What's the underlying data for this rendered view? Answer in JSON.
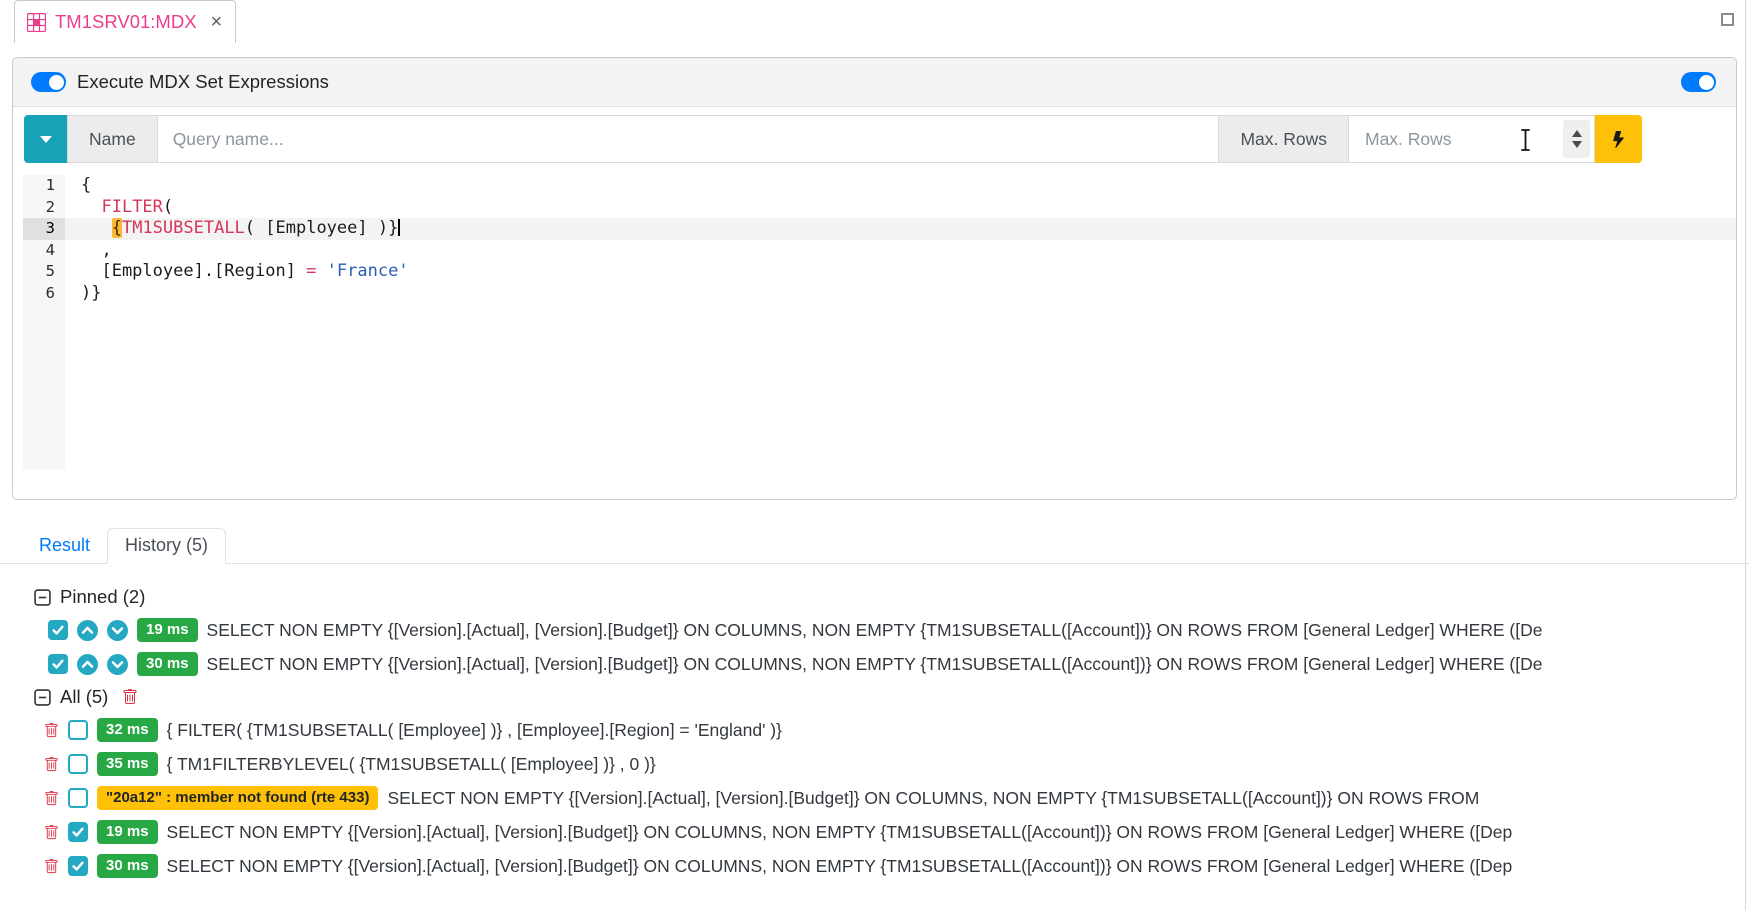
{
  "tab": {
    "title": "TM1SRV01:MDX",
    "close_glyph": "×"
  },
  "window": {
    "maximize_icon": "square-outline"
  },
  "toolbar": {
    "title": "Execute MDX Set Expressions",
    "toggle_left": "on",
    "toggle_right": "on"
  },
  "query_bar": {
    "dropdown_icon": "caret-down",
    "name_label": "Name",
    "name_placeholder": "Query name...",
    "name_value": "",
    "max_rows_label": "Max. Rows",
    "max_rows_placeholder": "Max. Rows",
    "max_rows_value": "",
    "execute_icon": "lightning-bolt"
  },
  "editor": {
    "lines": [
      {
        "no": 1,
        "active": false,
        "caret": false,
        "segments": [
          {
            "t": "plain",
            "v": "{"
          }
        ]
      },
      {
        "no": 2,
        "active": false,
        "caret": false,
        "segments": [
          {
            "t": "plain",
            "v": "  "
          },
          {
            "t": "keyword",
            "v": "FILTER"
          },
          {
            "t": "plain",
            "v": "("
          }
        ]
      },
      {
        "no": 3,
        "active": true,
        "caret": true,
        "segments": [
          {
            "t": "plain",
            "v": "   "
          },
          {
            "t": "brace",
            "v": "{"
          },
          {
            "t": "keyword",
            "v": "TM1SUBSETALL"
          },
          {
            "t": "plain",
            "v": "( [Employee] )}"
          }
        ]
      },
      {
        "no": 4,
        "active": false,
        "caret": false,
        "segments": [
          {
            "t": "plain",
            "v": "  ,"
          }
        ]
      },
      {
        "no": 5,
        "active": false,
        "caret": false,
        "segments": [
          {
            "t": "plain",
            "v": "  [Employee].[Region] "
          },
          {
            "t": "keyword",
            "v": "="
          },
          {
            "t": "plain",
            "v": " "
          },
          {
            "t": "string",
            "v": "'France'"
          }
        ]
      },
      {
        "no": 6,
        "active": false,
        "caret": false,
        "segments": [
          {
            "t": "plain",
            "v": ")}"
          }
        ]
      }
    ]
  },
  "tabs": {
    "result": "Result",
    "history": "History (5)"
  },
  "history": {
    "pinned": {
      "label": "Pinned (2)",
      "items": [
        {
          "checked": true,
          "badge": "19 ms",
          "badge_type": "success",
          "text": "SELECT NON EMPTY {[Version].[Actual], [Version].[Budget]} ON COLUMNS, NON EMPTY {TM1SUBSETALL([Account])} ON ROWS FROM [General Ledger] WHERE ([De"
        },
        {
          "checked": true,
          "badge": "30 ms",
          "badge_type": "success",
          "text": "SELECT NON EMPTY {[Version].[Actual], [Version].[Budget]} ON COLUMNS, NON EMPTY {TM1SUBSETALL([Account])} ON ROWS FROM [General Ledger] WHERE ([De"
        }
      ]
    },
    "all": {
      "label": "All (5)",
      "items": [
        {
          "checked": false,
          "badge": "32 ms",
          "badge_type": "success",
          "text": "{ FILTER( {TM1SUBSETALL( [Employee] )} , [Employee].[Region] = 'England' )}"
        },
        {
          "checked": false,
          "badge": "35 ms",
          "badge_type": "success",
          "text": "{ TM1FILTERBYLEVEL( {TM1SUBSETALL( [Employee] )} , 0 )}"
        },
        {
          "checked": false,
          "badge": "\"20a12\" : member not found (rte 433)",
          "badge_type": "warning",
          "text": "SELECT NON EMPTY {[Version].[Actual], [Version].[Budget]} ON COLUMNS, NON EMPTY {TM1SUBSETALL([Account])} ON ROWS FROM"
        },
        {
          "checked": true,
          "badge": "19 ms",
          "badge_type": "success",
          "text": "SELECT NON EMPTY {[Version].[Actual], [Version].[Budget]} ON COLUMNS, NON EMPTY {TM1SUBSETALL([Account])} ON ROWS FROM [General Ledger] WHERE ([Dep"
        },
        {
          "checked": true,
          "badge": "30 ms",
          "badge_type": "success",
          "text": "SELECT NON EMPTY {[Version].[Actual], [Version].[Budget]} ON COLUMNS, NON EMPTY {TM1SUBSETALL([Account])} ON ROWS FROM [General Ledger] WHERE ([Dep"
        }
      ]
    }
  },
  "colors": {
    "accent_teal": "#17a2b8",
    "checkbox_teal": "#25a8c2",
    "success_green": "#28a745",
    "warning_yellow": "#ffc107",
    "danger_red": "#dc3545",
    "tab_pink": "#e83e8c",
    "toggle_blue": "#007bff",
    "keyword_red": "#d5365a",
    "string_blue": "#2b5fb5",
    "brace_match_bg": "#fcb833"
  },
  "icons": {
    "tab_icon": "table-grid",
    "collapse": "minus-square",
    "delete": "trash",
    "pin_up": "chevron-up-circle",
    "pin_down": "chevron-down-circle",
    "mouse_cursor": "i-beam"
  }
}
